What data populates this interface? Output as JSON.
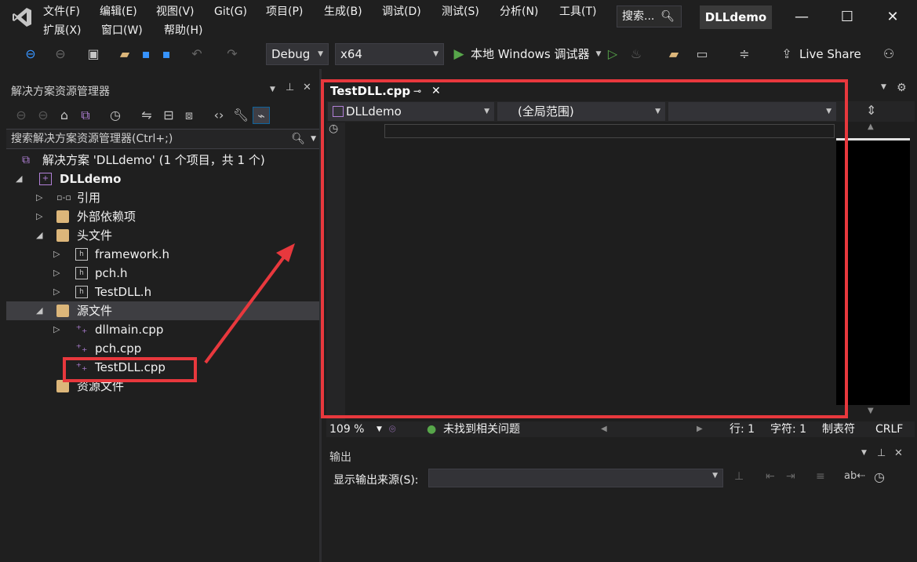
{
  "menu": {
    "row1": [
      "文件(F)",
      "编辑(E)",
      "视图(V)",
      "Git(G)",
      "项目(P)",
      "生成(B)",
      "调试(D)",
      "测试(S)",
      "分析(N)",
      "工具(T)"
    ],
    "row2": [
      "扩展(X)",
      "窗口(W)",
      "帮助(H)"
    ]
  },
  "search": {
    "label": "搜索...",
    "icon": "search-icon"
  },
  "window": {
    "title": "DLLdemo",
    "minimize": "—",
    "maximize": "☐",
    "close": "✕"
  },
  "toolbar": {
    "config": "Debug",
    "platform": "x64",
    "run_label": "本地 Windows 调试器",
    "live_share": "Live Share"
  },
  "solution_explorer": {
    "title": "解决方案资源管理器",
    "search_placeholder": "搜索解决方案资源管理器(Ctrl+;)",
    "tree": [
      {
        "label": "解决方案 'DLLdemo' (1 个项目，共 1 个)",
        "icon": "solution-icon"
      },
      {
        "label": "DLLdemo",
        "icon": "project-icon"
      },
      {
        "label": "引用",
        "icon": "references-icon"
      },
      {
        "label": "外部依赖项",
        "icon": "folder-icon"
      },
      {
        "label": "头文件",
        "icon": "filter-folder-icon"
      },
      {
        "label": "framework.h",
        "icon": "header-file-icon"
      },
      {
        "label": "pch.h",
        "icon": "header-file-icon"
      },
      {
        "label": "TestDLL.h",
        "icon": "header-file-icon"
      },
      {
        "label": "源文件",
        "icon": "filter-folder-icon"
      },
      {
        "label": "dllmain.cpp",
        "icon": "cpp-file-icon"
      },
      {
        "label": "pch.cpp",
        "icon": "cpp-file-icon"
      },
      {
        "label": "TestDLL.cpp",
        "icon": "cpp-file-icon"
      },
      {
        "label": "资源文件",
        "icon": "filter-folder-icon"
      }
    ]
  },
  "editor": {
    "tab": "TestDLL.cpp",
    "nav_project": "DLLdemo",
    "nav_scope": "(全局范围)",
    "nav_member": ""
  },
  "status": {
    "zoom": "109 %",
    "issues": "未找到相关问题",
    "line": "行: 1",
    "col": "字符: 1",
    "tabs": "制表符",
    "eol": "CRLF"
  },
  "output": {
    "title": "输出",
    "source_label": "显示输出来源(S):",
    "source_value": ""
  },
  "colors": {
    "accent": "#e8383d",
    "bg": "#1f1f1f",
    "run_green": "#57a64a",
    "vs_purple": "#b180d7"
  }
}
